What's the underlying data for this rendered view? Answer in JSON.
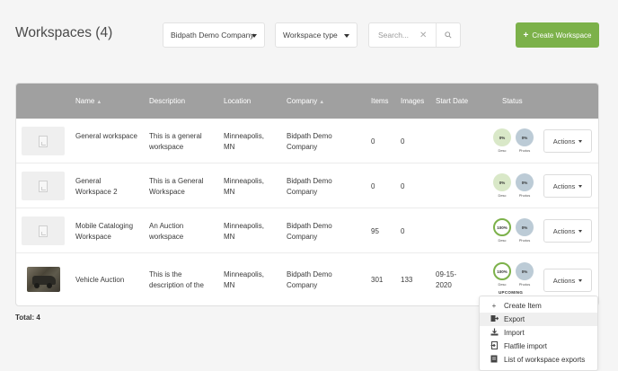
{
  "header": {
    "title": "Workspaces (4)",
    "company_select": "Bidpath Demo Company",
    "type_select": "Workspace type",
    "search_placeholder": "Search...",
    "create_button": "Create Workspace"
  },
  "table": {
    "columns": [
      "Name",
      "Description",
      "Location",
      "Company",
      "Items",
      "Images",
      "Start Date",
      "Status"
    ],
    "rows": [
      {
        "name": "General workspace",
        "description": "This is a general workspace",
        "location": "Minneapolis, MN",
        "company": "Bidpath Demo Company",
        "items": "0",
        "images": "0",
        "start_date": "",
        "desc_pct": "0%",
        "photo_pct": "0%",
        "desc_label": "Desc",
        "photo_label": "Photos",
        "actions": "Actions",
        "desc_full": false
      },
      {
        "name": "General Workspace 2",
        "description": "This is a General Workspace",
        "location": "Minneapolis, MN",
        "company": "Bidpath Demo Company",
        "items": "0",
        "images": "0",
        "start_date": "",
        "desc_pct": "0%",
        "photo_pct": "0%",
        "desc_label": "Desc",
        "photo_label": "Photos",
        "actions": "Actions",
        "desc_full": false
      },
      {
        "name": "Mobile Cataloging Workspace",
        "description": "An Auction workspace",
        "location": "Minneapolis, MN",
        "company": "Bidpath Demo Company",
        "items": "95",
        "images": "0",
        "start_date": "",
        "desc_pct": "100%",
        "photo_pct": "0%",
        "desc_label": "Desc",
        "photo_label": "Photos",
        "actions": "Actions",
        "desc_full": true
      },
      {
        "name": "Vehicle Auction",
        "description": "This is the description of the",
        "location": "Minneapolis, MN",
        "company": "Bidpath Demo Company",
        "items": "301",
        "images": "133",
        "start_date": "09-15-2020",
        "desc_pct": "100%",
        "photo_pct": "0%",
        "desc_label": "Desc",
        "photo_label": "Photos",
        "actions": "Actions",
        "desc_full": true,
        "status_badge": "UPCOMING"
      }
    ]
  },
  "footer": {
    "total": "Total: 4"
  },
  "dropdown": {
    "items": [
      {
        "icon": "plus-icon",
        "label": "Create Item"
      },
      {
        "icon": "export-icon",
        "label": "Export"
      },
      {
        "icon": "import-icon",
        "label": "Import"
      },
      {
        "icon": "flatfile-icon",
        "label": "Flatfile import"
      },
      {
        "icon": "document-icon",
        "label": "List of workspace exports"
      }
    ]
  },
  "colors": {
    "accent_green": "#7cb14a",
    "table_header": "#a0a0a0",
    "desc_circle": "#d9e8c8",
    "photo_circle": "#bccbd6"
  }
}
